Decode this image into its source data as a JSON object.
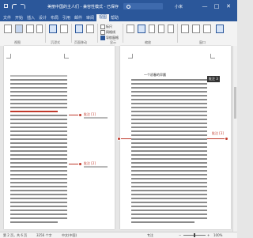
{
  "app": {
    "document_title": "美丽中国的主人们 - 兼容性模式 - 已保存",
    "search_placeholder": "搜索",
    "user_name": "小米"
  },
  "window_controls": {
    "minimize": "—",
    "maximize": "□",
    "close": "✕"
  },
  "tabs": [
    "文件",
    "开始",
    "插入",
    "设计",
    "布局",
    "引用",
    "邮件",
    "审阅",
    "视图",
    "帮助"
  ],
  "active_tab": "视图",
  "ribbon": {
    "groups": [
      {
        "name": "视图",
        "buttons": [
          "阅读视图",
          "页面视图",
          "Web版式视图",
          "大纲",
          "草稿"
        ]
      },
      {
        "name": "沉浸式",
        "buttons": [
          "专注",
          "沉浸式阅读器"
        ]
      },
      {
        "name": "页面移动",
        "buttons": [
          "垂直",
          "翻页"
        ]
      },
      {
        "name": "显示",
        "checkboxes": [
          {
            "label": "标尺",
            "checked": false
          },
          {
            "label": "网格线",
            "checked": false
          },
          {
            "label": "导航窗格",
            "checked": true
          }
        ]
      },
      {
        "name": "缩放",
        "buttons": [
          "缩放",
          "100%",
          "单页",
          "多页",
          "页宽"
        ]
      },
      {
        "name": "窗口",
        "buttons": [
          "新建窗口",
          "全部重排",
          "拆分",
          "切换窗口"
        ]
      }
    ]
  },
  "pages": {
    "left": {
      "comments": [
        {
          "author": "批注 [1]"
        },
        {
          "author": "批注 [2]"
        }
      ]
    },
    "right": {
      "heading": "一个初春的早晨",
      "comments": [
        {
          "author": "批注 [3]"
        }
      ],
      "side_tab": "批注 3"
    }
  },
  "status": {
    "page": "第 2 页，共 6 页",
    "words": "3256 个字",
    "language": "中文(中国)",
    "focus": "专注",
    "zoom_percent": "100%",
    "zoom_minus": "−",
    "zoom_plus": "+"
  },
  "colors": {
    "brand": "#2b579a",
    "comment": "#c0392b"
  }
}
